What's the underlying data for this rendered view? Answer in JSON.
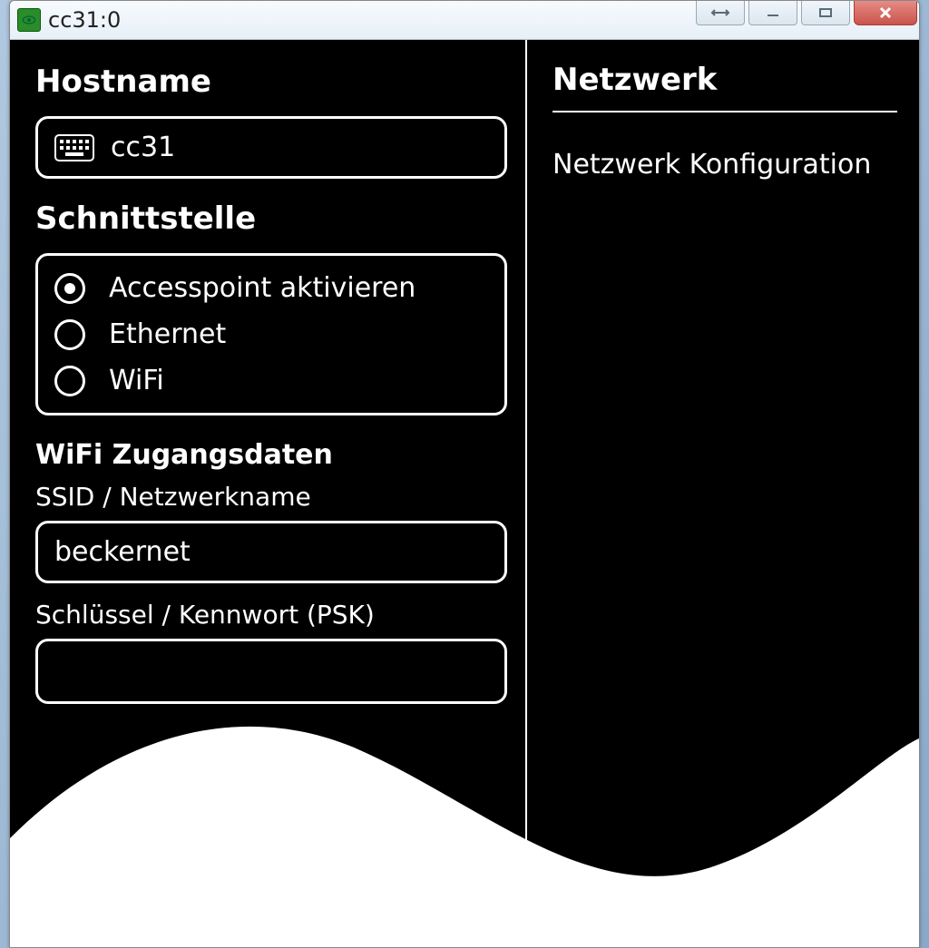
{
  "window": {
    "title": "cc31:0"
  },
  "left": {
    "hostname_heading": "Hostname",
    "hostname_value": "cc31",
    "interface_heading": "Schnittstelle",
    "interfaces": [
      {
        "label": "Accesspoint aktivieren",
        "selected": true
      },
      {
        "label": "Ethernet",
        "selected": false
      },
      {
        "label": "WiFi",
        "selected": false
      }
    ],
    "wifi_heading": "WiFi Zugangsdaten",
    "ssid_label": "SSID / Netzwerkname",
    "ssid_value": "beckernet",
    "psk_label": "Schlüssel / Kennwort (PSK)"
  },
  "right": {
    "title": "Netzwerk",
    "item": "Netzwerk Konfiguration"
  }
}
